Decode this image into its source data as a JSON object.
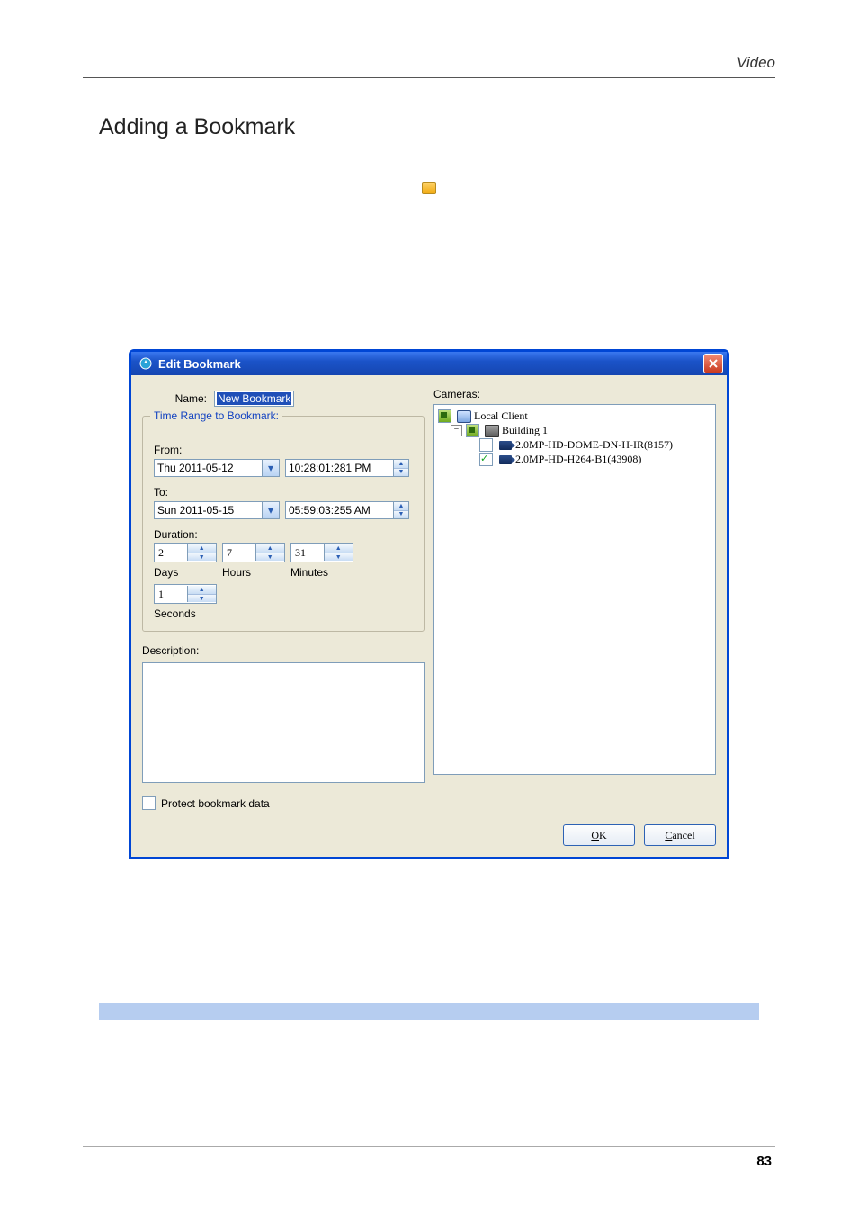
{
  "page": {
    "header": "Video",
    "section_title": "Adding a Bookmark",
    "page_number": "83"
  },
  "dialog": {
    "title": "Edit Bookmark",
    "name_label": "Name:",
    "name_value": "New Bookmark",
    "group_legend": "Time Range to Bookmark:",
    "from_label": "From:",
    "from_date": "Thu 2011-05-12",
    "from_time": "10:28:01:281  PM",
    "to_label": "To:",
    "to_date": "Sun 2011-05-15",
    "to_time": "05:59:03:255  AM",
    "duration_label": "Duration:",
    "duration": {
      "days": "2",
      "hours": "7",
      "minutes": "31",
      "seconds": "1",
      "days_label": "Days",
      "hours_label": "Hours",
      "minutes_label": "Minutes",
      "seconds_label": "Seconds"
    },
    "description_label": "Description:",
    "description_value": "",
    "protect_label": "Protect bookmark data",
    "cameras_label": "Cameras:",
    "tree": {
      "root": "Local Client",
      "group": "Building 1",
      "cam1": "2.0MP-HD-DOME-DN-H-IR(8157)",
      "cam2": "2.0MP-HD-H264-B1(43908)"
    },
    "ok_label": "OK",
    "cancel_label": "Cancel"
  }
}
